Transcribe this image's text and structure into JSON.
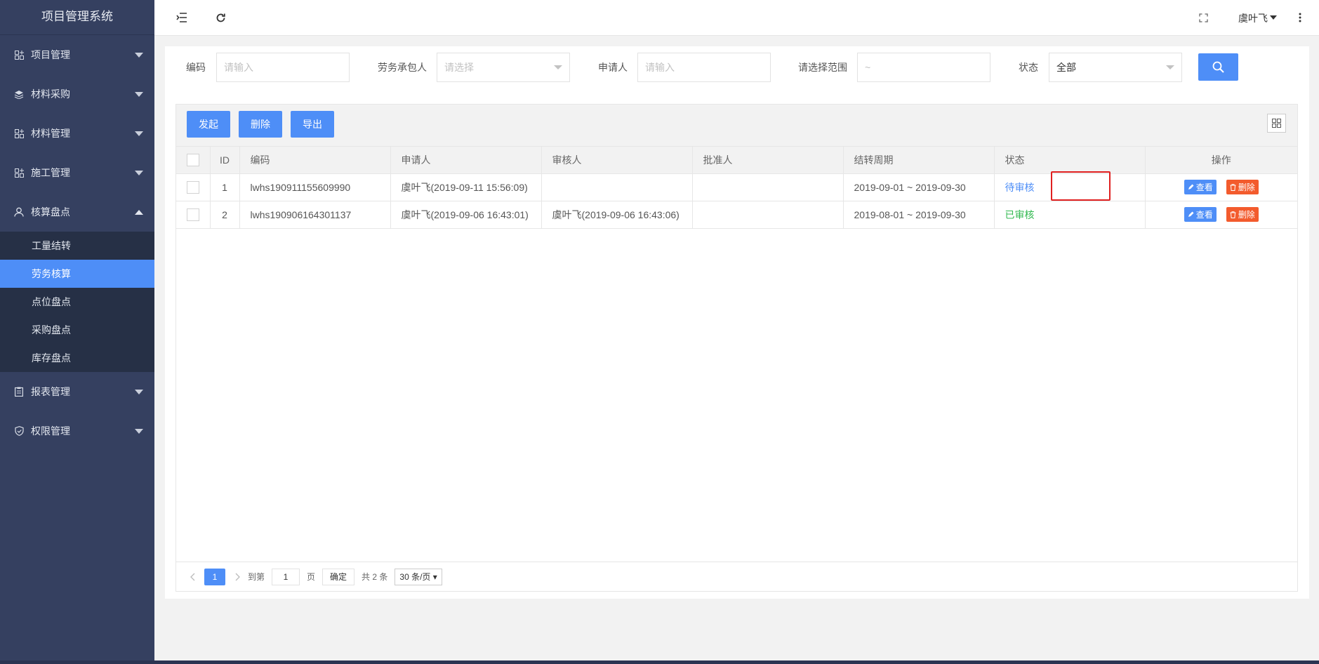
{
  "app": {
    "title": "项目管理系统"
  },
  "sidebar": {
    "items": [
      {
        "label": "项目管理",
        "icon": "grid-plus-icon",
        "expanded": false
      },
      {
        "label": "材料采购",
        "icon": "layers-icon",
        "expanded": false
      },
      {
        "label": "材料管理",
        "icon": "grid-plus-icon",
        "expanded": false
      },
      {
        "label": "施工管理",
        "icon": "grid-plus-icon",
        "expanded": false
      },
      {
        "label": "核算盘点",
        "icon": "user-icon",
        "expanded": true
      },
      {
        "label": "报表管理",
        "icon": "clipboard-icon",
        "expanded": false
      },
      {
        "label": "权限管理",
        "icon": "shield-check-icon",
        "expanded": false
      }
    ],
    "submenu": [
      {
        "label": "工量结转",
        "active": false
      },
      {
        "label": "劳务核算",
        "active": true
      },
      {
        "label": "点位盘点",
        "active": false
      },
      {
        "label": "采购盘点",
        "active": false
      },
      {
        "label": "库存盘点",
        "active": false
      }
    ]
  },
  "header": {
    "user": "虞叶飞"
  },
  "filters": {
    "code": {
      "label": "编码",
      "placeholder": "请输入"
    },
    "contractor": {
      "label": "劳务承包人",
      "placeholder": "请选择"
    },
    "applicant": {
      "label": "申请人",
      "placeholder": "请输入"
    },
    "range": {
      "label": "请选择范围",
      "placeholder": "~"
    },
    "status": {
      "label": "状态",
      "value": "全部"
    }
  },
  "toolbar": {
    "start": "发起",
    "delete": "删除",
    "export": "导出"
  },
  "table": {
    "headers": [
      "ID",
      "编码",
      "申请人",
      "审核人",
      "批准人",
      "结转周期",
      "状态",
      "操作"
    ],
    "rows": [
      {
        "id": "1",
        "code": "lwhs190911155609990",
        "applicant": "虞叶飞(2019-09-11 15:56:09)",
        "reviewer": "",
        "approver": "",
        "period": "2019-09-01 ~ 2019-09-30",
        "status": "待审核"
      },
      {
        "id": "2",
        "code": "lwhs190906164301137",
        "applicant": "虞叶飞(2019-09-06 16:43:01)",
        "reviewer": "虞叶飞(2019-09-06 16:43:06)",
        "approver": "",
        "period": "2019-08-01 ~ 2019-09-30",
        "status": "已审核"
      }
    ],
    "view_label": "查看",
    "delete_label": "删除"
  },
  "pagination": {
    "current": "1",
    "goto_label": "到第",
    "goto_value": "1",
    "page_unit": "页",
    "confirm": "确定",
    "total": "共 2 条",
    "page_size": "30 条/页"
  },
  "colors": {
    "sidebar": "#354060",
    "submenu": "#263046",
    "accent": "#4e8ef7",
    "danger": "#f35b2d",
    "success": "#32b950",
    "highlight": "#e02020"
  }
}
